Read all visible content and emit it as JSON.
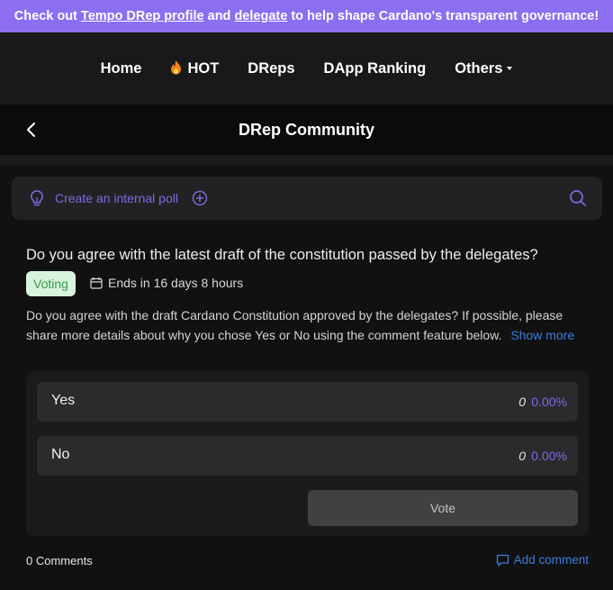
{
  "banner": {
    "prefix": "Check out ",
    "link1": "Tempo DRep profile",
    "middle": " and ",
    "link2": "delegate",
    "suffix": " to help shape Cardano's transparent governance!"
  },
  "nav": {
    "home": "Home",
    "hot": "HOT",
    "dreps": "DReps",
    "dapp_ranking": "DApp Ranking",
    "others": "Others"
  },
  "page": {
    "title": "DRep Community"
  },
  "poll_bar": {
    "label": "Create an internal poll"
  },
  "poll": {
    "question": "Do you agree with the latest draft of the constitution passed by the delegates?",
    "status": "Voting",
    "ends": "Ends in 16 days 8 hours",
    "description": "Do you agree with the draft Cardano Constitution approved by the delegates? If possible, please share more details about why you chose Yes or No using the comment feature below.",
    "show_more": "Show more",
    "options": [
      {
        "label": "Yes",
        "count": "0",
        "percent": "0.00%"
      },
      {
        "label": "No",
        "count": "0",
        "percent": "0.00%"
      }
    ],
    "vote_label": "Vote"
  },
  "footer": {
    "comments": "0 Comments",
    "add_comment": "Add comment"
  },
  "colors": {
    "banner_bg": "#8c6ef0",
    "accent_purple": "#7f6be0",
    "link_blue": "#3b7dd8",
    "badge_bg": "#d9f4dc",
    "badge_text": "#3a9a48"
  },
  "icons": {
    "fire": "fire-icon",
    "back": "chevron-left-icon",
    "bulb": "lightbulb-icon",
    "plus": "plus-circle-icon",
    "search": "search-icon",
    "calendar": "calendar-icon",
    "comment": "comment-icon"
  }
}
